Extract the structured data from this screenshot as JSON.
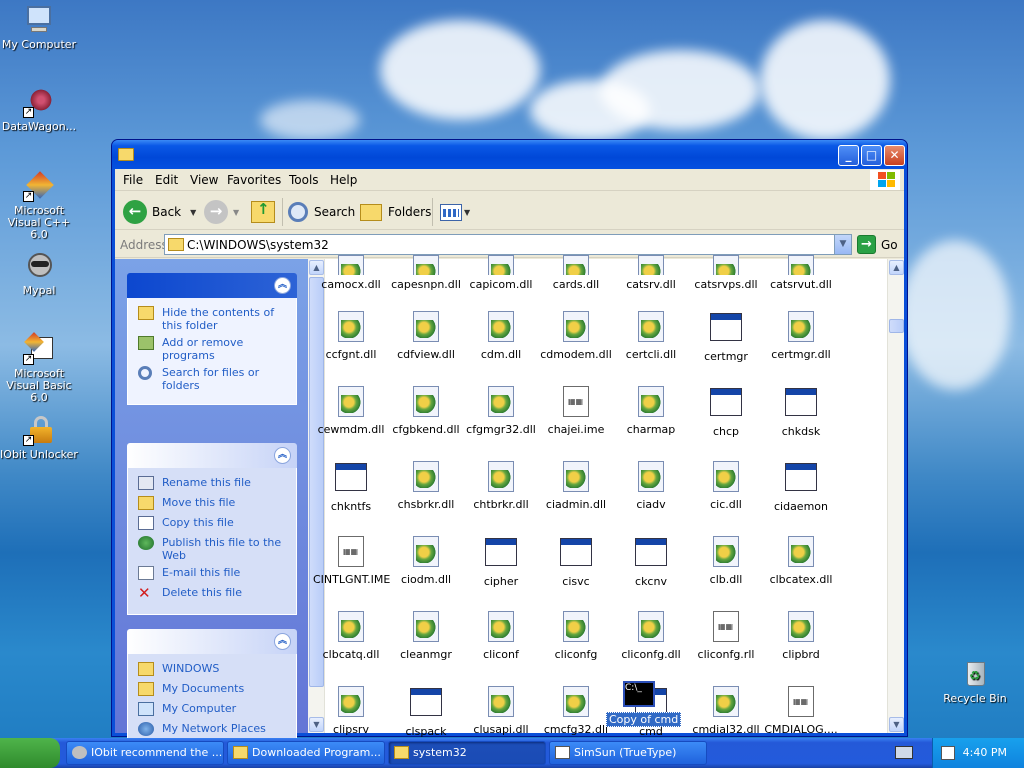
{
  "desktop": {
    "icons": [
      {
        "label": "My Computer"
      },
      {
        "label": "DataWagon..."
      },
      {
        "label": "Microsoft Visual C++ 6.0"
      },
      {
        "label": "Mypal"
      },
      {
        "label": "Microsoft Visual Basic 6.0"
      },
      {
        "label": "IObit Unlocker"
      },
      {
        "label": "Recycle Bin"
      }
    ]
  },
  "window": {
    "menu": [
      "File",
      "Edit",
      "View",
      "Favorites",
      "Tools",
      "Help"
    ],
    "toolbar": {
      "back": "Back",
      "search": "Search",
      "folders": "Folders"
    },
    "address": {
      "label": "Address",
      "path": "C:\\WINDOWS\\system32",
      "go": "Go"
    },
    "file_tasks": [
      "Hide the contents of this folder",
      "Add or remove programs",
      "Search for files or folders"
    ],
    "file_ops": [
      "Rename this file",
      "Move this file",
      "Copy this file",
      "Publish this file to the Web",
      "E-mail this file",
      "Delete this file"
    ],
    "other_places": [
      "WINDOWS",
      "My Documents",
      "My Computer",
      "My Network Places"
    ],
    "files": [
      [
        "camocx.dll",
        "capesnpn.dll",
        "capicom.dll",
        "cards.dll",
        "catsrv.dll",
        "catsrvps.dll",
        "catsrvut.dll"
      ],
      [
        "ccfgnt.dll",
        "cdfview.dll",
        "cdm.dll",
        "cdmodem.dll",
        "certcli.dll",
        "certmgr",
        "certmgr.dll"
      ],
      [
        "cewmdm.dll",
        "cfgbkend.dll",
        "cfgmgr32.dll",
        "chajei.ime",
        "charmap",
        "chcp",
        "chkdsk"
      ],
      [
        "chkntfs",
        "chsbrkr.dll",
        "chtbrkr.dll",
        "ciadmin.dll",
        "ciadv",
        "cic.dll",
        "cidaemon"
      ],
      [
        "CINTLGNT.IME",
        "ciodm.dll",
        "cipher",
        "cisvc",
        "ckcnv",
        "clb.dll",
        "clbcatex.dll"
      ],
      [
        "clbcatq.dll",
        "cleanmgr",
        "cliconf",
        "cliconfg",
        "cliconfg.dll",
        "cliconfg.rll",
        "clipbrd"
      ],
      [
        "clipsrv",
        "clspack",
        "clusapi.dll",
        "cmcfg32.dll",
        "cmd",
        "cmdial32.dll",
        "CMDIALOG...."
      ]
    ],
    "drag_label": "Copy of cmd"
  },
  "taskbar": {
    "buttons": [
      "IObit recommend the ...",
      "Downloaded Program...",
      "system32",
      "SimSun (TrueType)"
    ],
    "clock": "4:40 PM"
  }
}
